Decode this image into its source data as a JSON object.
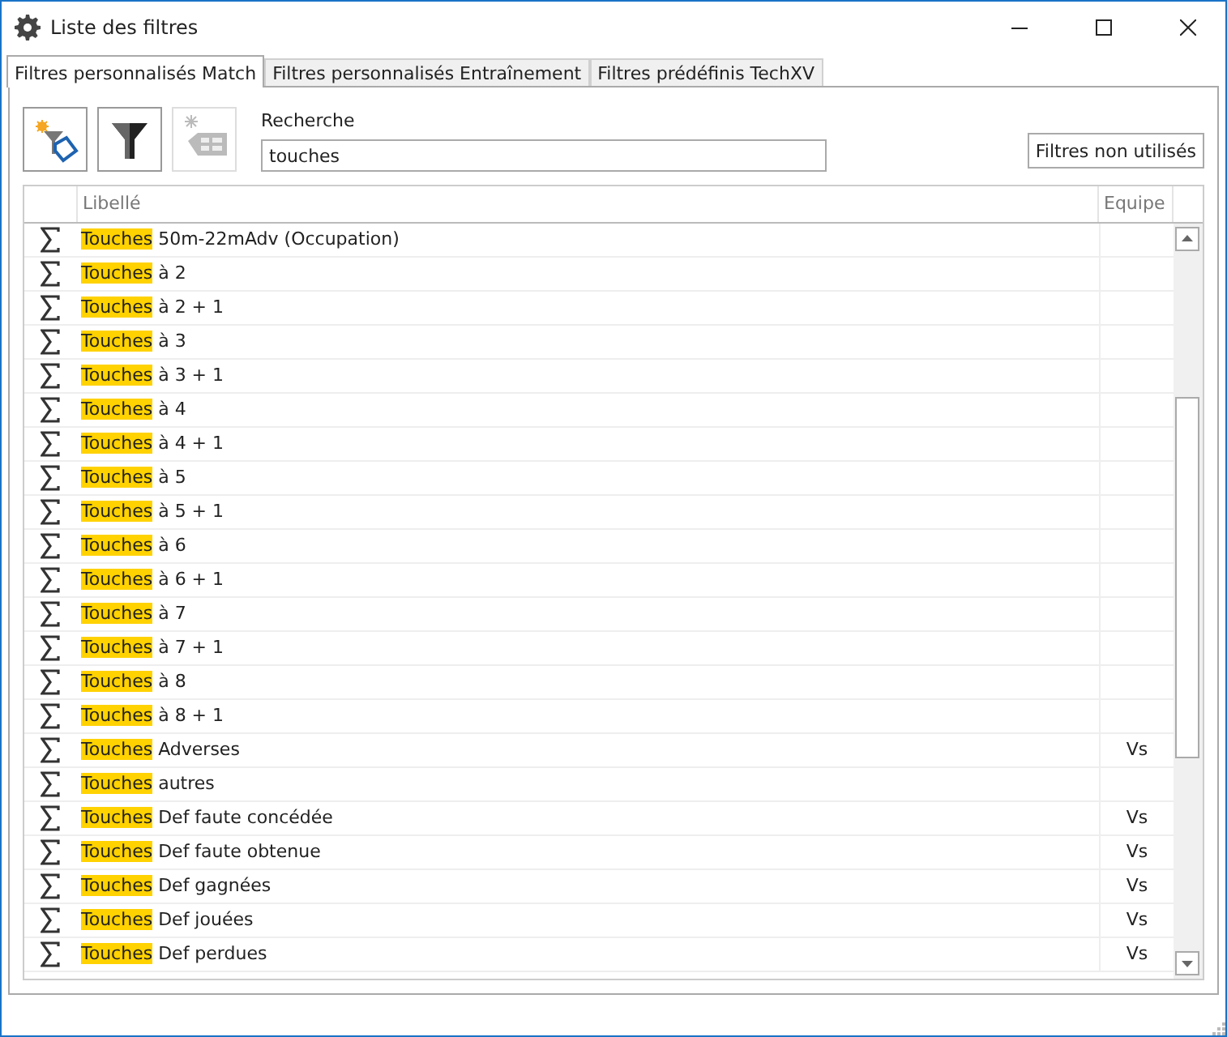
{
  "window": {
    "title": "Liste des filtres"
  },
  "tabs": [
    {
      "label": "Filtres personnalisés Match",
      "selected": true
    },
    {
      "label": "Filtres personnalisés Entraînement",
      "selected": false
    },
    {
      "label": "Filtres prédéfinis TechXV",
      "selected": false
    }
  ],
  "toolbar": [
    {
      "kind": "new-filter",
      "disabled": false
    },
    {
      "kind": "filter",
      "disabled": false
    },
    {
      "kind": "new-tag",
      "disabled": true
    }
  ],
  "search": {
    "label": "Recherche",
    "value": "touches"
  },
  "unused_button": "Filtres non utilisés",
  "table": {
    "columns": [
      "Libellé",
      "Equipe"
    ],
    "rows": [
      {
        "highlight": "Touches",
        "rest": "50m-22mAdv (Occupation)"
      },
      {
        "highlight": "Touches",
        "rest": "à 2"
      },
      {
        "highlight": "Touches",
        "rest": "à 2 + 1"
      },
      {
        "highlight": "Touches",
        "rest": "à 3"
      },
      {
        "highlight": "Touches",
        "rest": "à 3 + 1"
      },
      {
        "highlight": "Touches",
        "rest": "à 4"
      },
      {
        "highlight": "Touches",
        "rest": "à 4 + 1"
      },
      {
        "highlight": "Touches",
        "rest": "à 5"
      },
      {
        "highlight": "Touches",
        "rest": "à 5 + 1"
      },
      {
        "highlight": "Touches",
        "rest": "à 6"
      },
      {
        "highlight": "Touches",
        "rest": "à 6 + 1"
      },
      {
        "highlight": "Touches",
        "rest": "à 7"
      },
      {
        "highlight": "Touches",
        "rest": "à 7 + 1"
      },
      {
        "highlight": "Touches",
        "rest": "à 8"
      },
      {
        "highlight": "Touches",
        "rest": "à 8 + 1"
      },
      {
        "highlight": "Touches",
        "rest": "Adverses",
        "team": "Vs"
      },
      {
        "highlight": "Touches",
        "rest": "autres"
      },
      {
        "highlight": "Touches",
        "rest": "Def faute concédée",
        "team": "Vs"
      },
      {
        "highlight": "Touches",
        "rest": "Def faute obtenue",
        "team": "Vs"
      },
      {
        "highlight": "Touches",
        "rest": "Def gagnées",
        "team": "Vs"
      },
      {
        "highlight": "Touches",
        "rest": "Def jouées",
        "team": "Vs"
      },
      {
        "highlight": "Touches",
        "rest": "Def perdues",
        "team": "Vs"
      }
    ]
  }
}
